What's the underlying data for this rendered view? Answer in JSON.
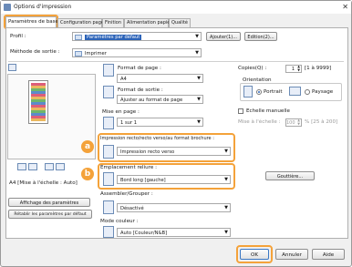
{
  "window": {
    "title": "Options d'impression",
    "close_glyph": "✕"
  },
  "tabs": [
    {
      "label": "Paramètres de base"
    },
    {
      "label": "Configuration page"
    },
    {
      "label": "Finition"
    },
    {
      "label": "Alimentation papier"
    },
    {
      "label": "Qualité"
    }
  ],
  "profile": {
    "label": "Profil :",
    "value": "Paramètres par défaut",
    "add_button": "Ajouter(1)...",
    "edit_button": "Edition(2)..."
  },
  "output_method": {
    "label": "Méthode de sortie :",
    "value": "Imprimer"
  },
  "page_size": {
    "label": "Format de page :",
    "value": "A4"
  },
  "output_size": {
    "label": "Format de sortie :",
    "value": "Ajuster au format de page"
  },
  "layout": {
    "label": "Mise en page :",
    "value": "1 sur 1"
  },
  "copies": {
    "label": "Copies(Q) :",
    "value": "1",
    "range": "[1 à 9999]"
  },
  "orientation": {
    "label": "Orientation",
    "portrait": "Portrait",
    "landscape": "Paysage",
    "selected": "Portrait"
  },
  "manual_scaling": {
    "label": "Echelle manuelle",
    "checked": false,
    "scale_label": "Mise à l'échelle :",
    "scale_value": "100",
    "scale_range": "% [25 à 200]"
  },
  "duplex": {
    "label": "Impression recto/recto verso/au format brochure :",
    "value": "Impression recto verso",
    "marker": "a"
  },
  "binding": {
    "label": "Emplacement reliure :",
    "value": "Bord long [gauche]",
    "marker": "b",
    "gutter_button": "Gouttière..."
  },
  "collate": {
    "label": "Assembler/Grouper :",
    "value": "Désactivé"
  },
  "color_mode": {
    "label": "Mode couleur :",
    "value": "Auto [Couleur/N&B]"
  },
  "preview": {
    "caption": "A4 [Mise à l'échelle : Auto]"
  },
  "left_buttons": {
    "view_settings": "Affichage des paramètres",
    "restore_defaults": "Rétablir les paramètres par défaut"
  },
  "footer": {
    "ok": "OK",
    "cancel": "Annuler",
    "help": "Aide"
  },
  "colors": {
    "highlight": "#f4a23a",
    "accent": "#2a62b8"
  }
}
